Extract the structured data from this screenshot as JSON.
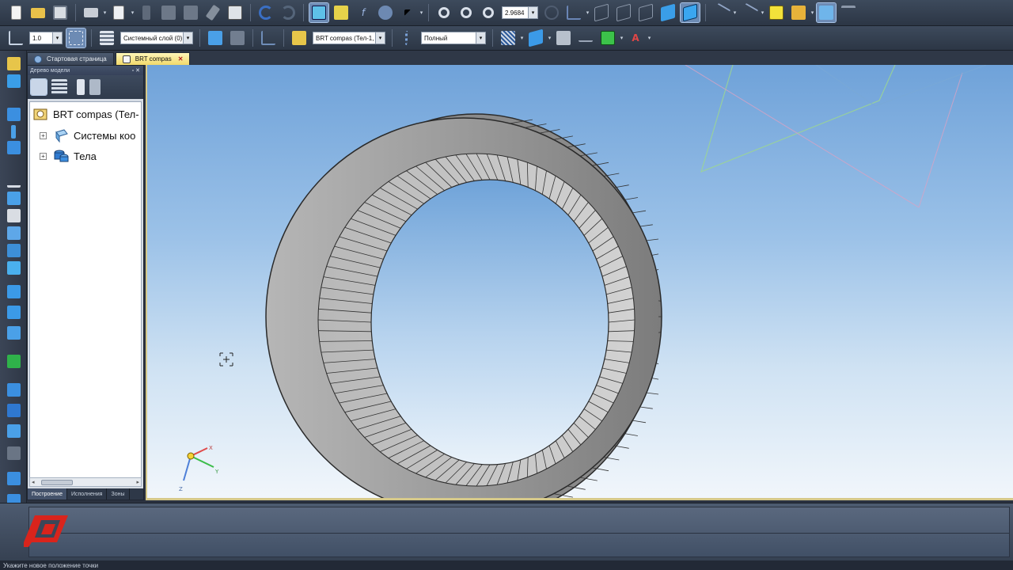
{
  "toolbar_top": {
    "zoom_value": "2.9684",
    "icons": [
      "new-file-icon",
      "open-icon",
      "save-icon",
      "print-icon",
      "preview-icon",
      "cut-icon",
      "copy-icon",
      "paste-icon",
      "format-painter-icon",
      "properties-icon",
      "undo-icon",
      "redo-icon",
      "manager-icon",
      "help-icon",
      "formula-icon",
      "variables-icon",
      "help-cursor-icon",
      "zoom-window-icon",
      "zoom-icon",
      "zoom-in-icon",
      "rotate-icon",
      "orient-icon",
      "wireframe-icon",
      "hidden-lines-icon",
      "hidden-thin-icon",
      "halftone-icon",
      "halftone-edges-icon",
      "perspective-icon",
      "section-icon",
      "filter-icon",
      "cube-icon",
      "measure-icon",
      "props-icon"
    ]
  },
  "toolbar_second": {
    "step_value": "1.0",
    "layer_value": "Системный слой (0)",
    "part_value": "BRT compas (Тел-1,",
    "mode_value": "Полный"
  },
  "tabs": [
    {
      "label": "Стартовая страница",
      "active": false
    },
    {
      "label": "BRT compas",
      "active": true,
      "close": "✕"
    }
  ],
  "tree_panel": {
    "title": "Дерево модели",
    "nodes": [
      {
        "label": "BRT compas (Тел-",
        "icon": "part-icon"
      },
      {
        "label": "Системы коо",
        "icon": "coordinate-system-icon"
      },
      {
        "label": "Тела",
        "icon": "bodies-icon"
      }
    ],
    "bottom_tabs": [
      "Построение",
      "Исполнения",
      "Зоны"
    ]
  },
  "axes": {
    "x": "X",
    "y": "Y",
    "z": "Z"
  },
  "status_text": "Укажите новое положение точки",
  "colors": {
    "toolbar_bg": "#2c3645",
    "viewport_top": "#6fa2d9",
    "viewport_bottom": "#f1f6fb",
    "active_tab": "#f1d96b",
    "logo_red": "#d9241c"
  }
}
